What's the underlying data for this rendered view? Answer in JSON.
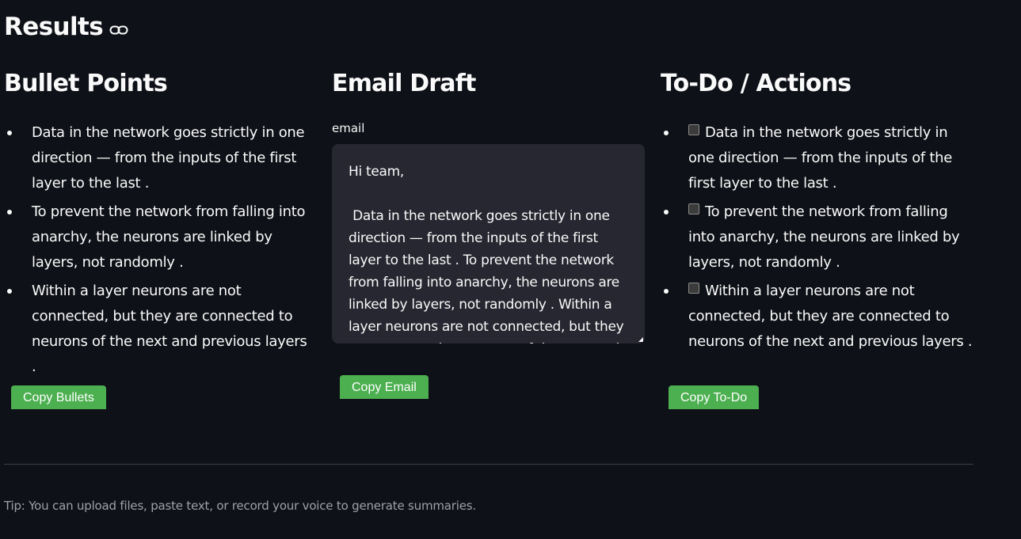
{
  "results": {
    "title": "Results",
    "link_icon": "link-icon"
  },
  "bullets": {
    "title": "Bullet Points",
    "items": [
      "Data in the network goes strictly in one direction — from the inputs of the first layer to the last .",
      "To prevent the network from falling into anarchy, the neurons are linked by layers, not randomly .",
      "Within a layer neurons are not connected, but they are connected to neurons of the next and previous layers ."
    ],
    "copy_label": "Copy Bullets"
  },
  "email": {
    "title": "Email Draft",
    "label": "email",
    "value": "Hi team,\n\n Data in the network goes strictly in one direction — from the inputs of the first layer to the last . To prevent the network from falling into anarchy, the neurons are linked by layers, not randomly . Within a layer neurons are not connected, but they are connected to neurons of the next and previous layers .",
    "copy_label": "Copy Email"
  },
  "todo": {
    "title": "To-Do / Actions",
    "items": [
      "Data in the network goes strictly in one direction — from the inputs of the first layer to the last .",
      "To prevent the network from falling into anarchy, the neurons are linked by layers, not randomly .",
      "Within a layer neurons are not connected, but they are connected to neurons of the next and previous layers ."
    ],
    "copy_label": "Copy To-Do"
  },
  "footer": {
    "tip": "Tip: You can upload files, paste text, or record your voice to generate summaries."
  },
  "colors": {
    "background": "#0e1117",
    "button": "#4caf50",
    "textarea": "#262730"
  }
}
